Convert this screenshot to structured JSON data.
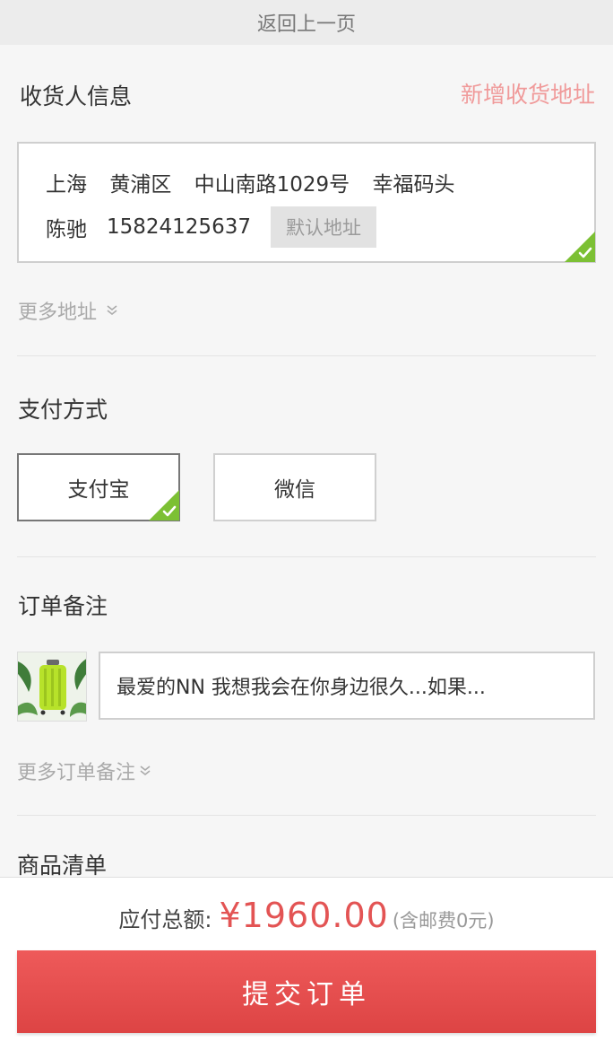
{
  "topbar": {
    "back_label": "返回上一页"
  },
  "consignee": {
    "title": "收货人信息",
    "add_link": "新增收货地址",
    "address": {
      "city": "上海",
      "district": "黄浦区",
      "street": "中山南路1029号",
      "place": "幸福码头",
      "name": "陈驰",
      "phone": "15824125637",
      "default_badge": "默认地址"
    },
    "more_label": "更多地址"
  },
  "payment": {
    "title": "支付方式",
    "options": [
      {
        "label": "支付宝",
        "selected": true
      },
      {
        "label": "微信",
        "selected": false
      }
    ]
  },
  "remark": {
    "title": "订单备注",
    "note_text": "最爱的NN 我想我会在你身边很久...如果...",
    "more_label": "更多订单备注"
  },
  "goods": {
    "title": "商品清单"
  },
  "footer": {
    "total_label": "应付总额:",
    "total_amount": "¥1960.00",
    "shipping_note": "(含邮费0元)",
    "submit_label": "提交订单"
  },
  "colors": {
    "accent_red": "#e35454",
    "link_pink": "#f09a9a",
    "check_green": "#7cc034"
  },
  "icons": {
    "check_corner": "check-corner-icon",
    "chevron": "chevron-double-down-icon"
  }
}
